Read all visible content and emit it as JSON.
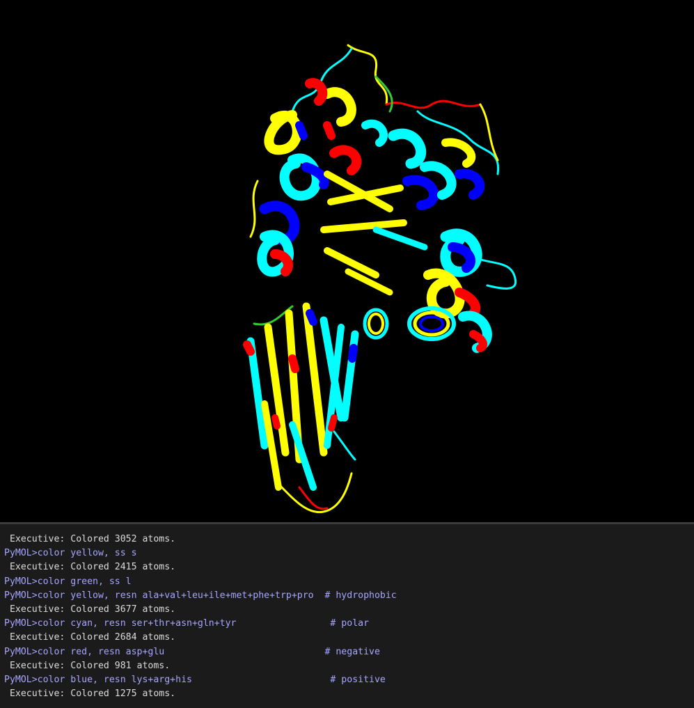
{
  "viewer": {
    "label": "pymol-3d-viewer",
    "colors": {
      "hydrophobic": "#ffff00",
      "polar": "#00ffff",
      "negative": "#ff0000",
      "positive": "#0000ff",
      "loop": "#33cc33",
      "background": "#000000"
    }
  },
  "console": {
    "lines": [
      {
        "kind": "out",
        "text": " Executive: Colored 3052 atoms."
      },
      {
        "kind": "cmd",
        "text": "PyMOL>color yellow, ss s"
      },
      {
        "kind": "out",
        "text": " Executive: Colored 2415 atoms."
      },
      {
        "kind": "cmd",
        "text": "PyMOL>color green, ss l"
      },
      {
        "kind": "cmd",
        "text": "PyMOL>color yellow, resn ala+val+leu+ile+met+phe+trp+pro  # hydrophobic"
      },
      {
        "kind": "out",
        "text": " Executive: Colored 3677 atoms."
      },
      {
        "kind": "cmd",
        "text": "PyMOL>color cyan, resn ser+thr+asn+gln+tyr                 # polar"
      },
      {
        "kind": "out",
        "text": " Executive: Colored 2684 atoms."
      },
      {
        "kind": "cmd",
        "text": "PyMOL>color red, resn asp+glu                             # negative"
      },
      {
        "kind": "out",
        "text": " Executive: Colored 981 atoms."
      },
      {
        "kind": "cmd",
        "text": "PyMOL>color blue, resn lys+arg+his                         # positive"
      },
      {
        "kind": "out",
        "text": " Executive: Colored 1275 atoms."
      }
    ]
  }
}
